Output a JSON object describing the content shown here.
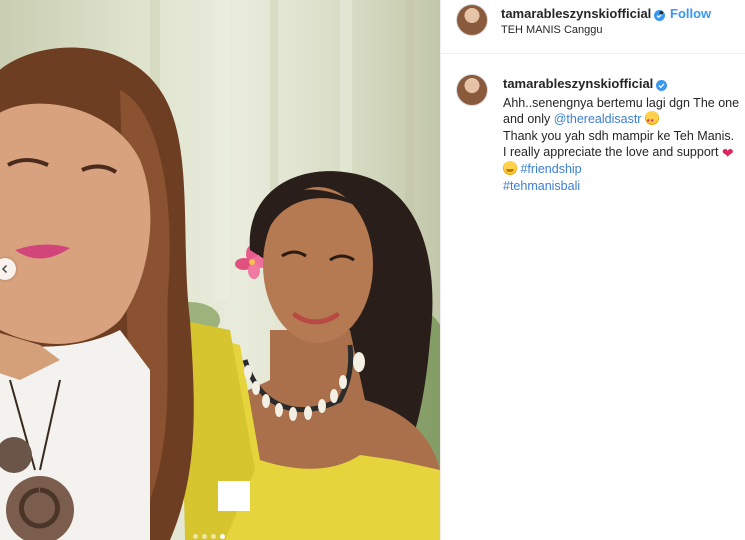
{
  "post": {
    "author": {
      "username": "tamarableszynskiofficial",
      "verified": true
    },
    "header": {
      "separator": "•",
      "follow_label": "Follow",
      "location": "TEH MANIS Canggu"
    },
    "caption": {
      "text_1": "Ahh..senengnya bertemu lagi dgn The one and only ",
      "mention": "@therealdisastr",
      "text_2": "Thank you yah sdh mampir ke Teh Manis. I really appreciate the love and support ",
      "hashtag_1": "#friendship",
      "hashtag_2": "#tehmanisbali",
      "emoji_1": "star-struck-face",
      "emoji_2": "red-heart",
      "emoji_3": "hugging-face"
    },
    "media": {
      "description_icons": [
        "chevron-left-icon"
      ],
      "carousel": {
        "total": 4,
        "active_index": 3
      }
    },
    "colors": {
      "link_blue": "#3897f0",
      "text": "#262626",
      "mention": "#00376b",
      "hashtag": "#3b7fd4"
    }
  }
}
